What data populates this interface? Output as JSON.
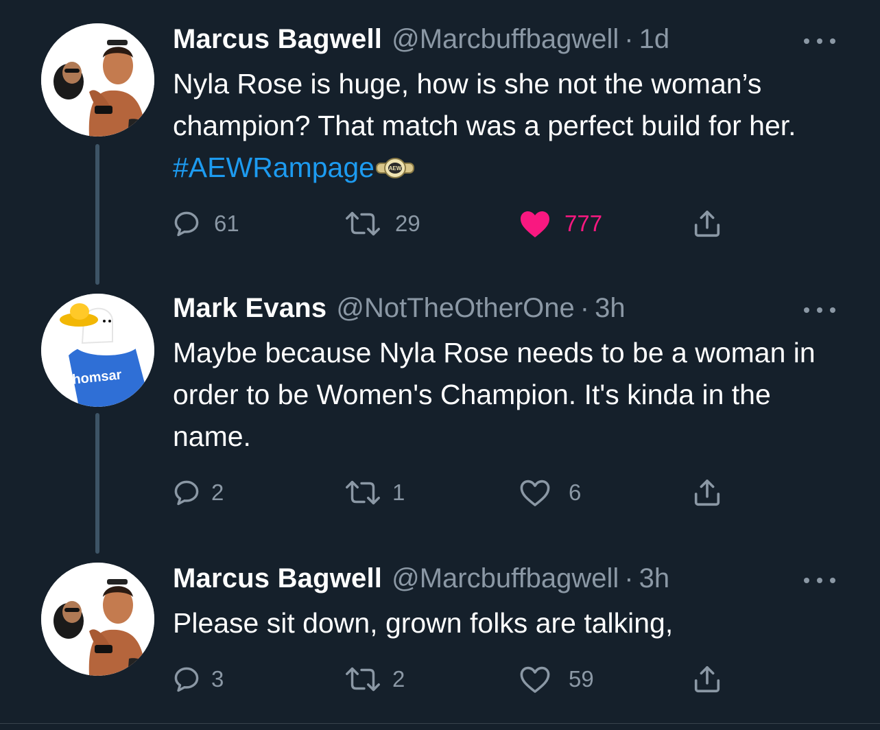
{
  "tweets": [
    {
      "name": "Marcus Bagwell",
      "handle": "@Marcbuffbagwell",
      "separator": "·",
      "time": "1d",
      "text_plain": "Nyla Rose is huge, how is she not the woman’s champion?  That match was a perfect build for her. ",
      "hashtag": "#AEWRampage",
      "replies": "61",
      "retweets": "29",
      "likes": "777",
      "liked": true
    },
    {
      "name": "Mark Evans",
      "handle": "@NotTheOtherOne",
      "separator": "·",
      "time": "3h",
      "text_plain": "Maybe because Nyla Rose needs to be a woman in order to be Women's Champion. It's kinda in the name.",
      "replies": "2",
      "retweets": "1",
      "likes": "6",
      "liked": false,
      "avatar_label": "homsar"
    },
    {
      "name": "Marcus Bagwell",
      "handle": "@Marcbuffbagwell",
      "separator": "·",
      "time": "3h",
      "text_plain": "Please sit down, grown folks are talking,",
      "replies": "3",
      "retweets": "2",
      "likes": "59",
      "liked": false
    }
  ],
  "belt_emoji_label": "AEW",
  "colors": {
    "background": "#15202b",
    "text": "#ffffff",
    "muted": "#8b98a5",
    "link": "#1d9bf0",
    "like": "#f91880",
    "thread_line": "#3d5466"
  }
}
